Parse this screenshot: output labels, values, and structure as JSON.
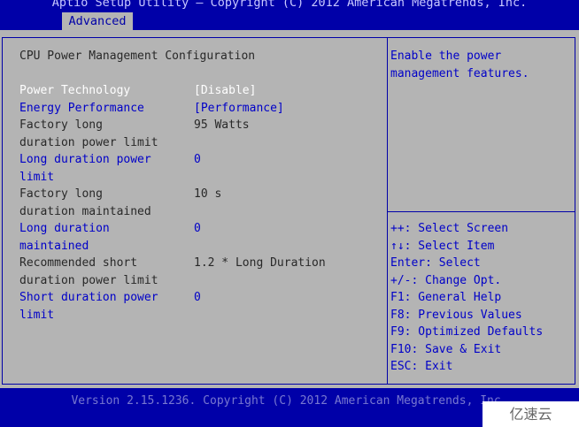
{
  "header": {
    "title": "Aptio Setup Utility – Copyright (C) 2012 American Megatrends, Inc.",
    "active_tab": "Advanced"
  },
  "main": {
    "section_title": "CPU Power Management Configuration",
    "items": [
      {
        "label1": "Power Technology",
        "label2": "",
        "value": "[Disable]",
        "state": "selected"
      },
      {
        "label1": "Energy Performance",
        "label2": "",
        "value": "[Performance]",
        "state": "editable"
      },
      {
        "label1": "Factory long",
        "label2": "duration power limit",
        "value": "95 Watts",
        "state": "readonly"
      },
      {
        "label1": "Long duration power",
        "label2": "limit",
        "value": "0",
        "state": "editable"
      },
      {
        "label1": "Factory long",
        "label2": "duration maintained",
        "value": "10 s",
        "state": "readonly"
      },
      {
        "label1": "Long duration",
        "label2": "maintained",
        "value": "0",
        "state": "editable"
      },
      {
        "label1": "Recommended short",
        "label2": "duration power limit",
        "value": "1.2 * Long Duration",
        "state": "readonly"
      },
      {
        "label1": "Short duration power",
        "label2": "limit",
        "value": "0",
        "state": "editable"
      }
    ]
  },
  "help": {
    "description_line1": "Enable the power",
    "description_line2": "management features.",
    "keys": [
      "++: Select Screen",
      "↑↓: Select Item",
      "Enter: Select",
      "+/-: Change Opt.",
      "F1: General Help",
      "F8: Previous Values",
      "F9: Optimized Defaults",
      "F10: Save & Exit",
      "ESC: Exit"
    ]
  },
  "footer": {
    "version": "Version 2.15.1236. Copyright (C) 2012 American Megatrends, Inc."
  },
  "watermark": "亿速云",
  "colors": {
    "background": "#0000a8",
    "panel": "#b4b4b4",
    "selected": "#ffffff",
    "editable": "#0000c8",
    "readonly": "#282828"
  }
}
